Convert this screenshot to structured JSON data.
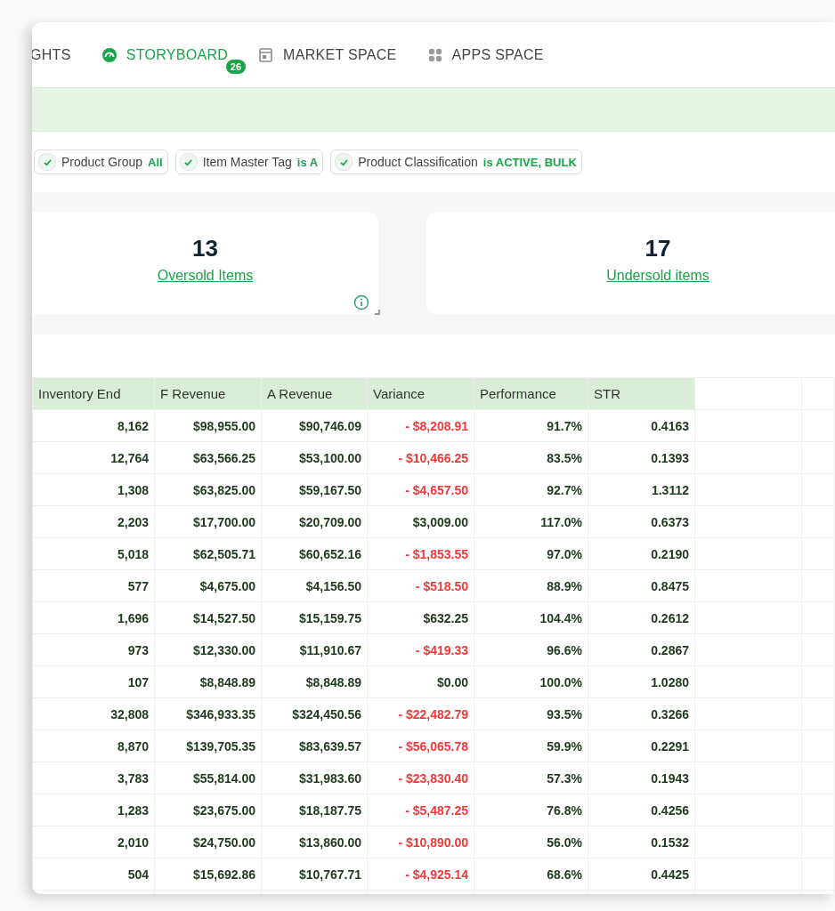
{
  "tabs": [
    {
      "label": "GHTS",
      "kind": "plain",
      "selected": false
    },
    {
      "label": "STORYBOARD",
      "kind": "gauge",
      "selected": true,
      "badge": "26"
    },
    {
      "label": "MARKET SPACE",
      "kind": "store",
      "selected": false
    },
    {
      "label": "APPS SPACE",
      "kind": "apps",
      "selected": false
    }
  ],
  "filters": [
    {
      "label": "Product Group",
      "value": "All",
      "checked": true
    },
    {
      "label": "Item Master Tag",
      "value": "is A",
      "checked": true
    },
    {
      "label": "Product Classification",
      "value": "is ACTIVE, BULK",
      "checked": true
    }
  ],
  "cards": [
    {
      "value": "13",
      "link": "Oversold Items",
      "info": true
    },
    {
      "value": "17",
      "link": "Undersold items",
      "info": false
    }
  ],
  "table": {
    "columns": [
      "Inventory End",
      "F Revenue",
      "A Revenue",
      "Variance",
      "Performance",
      "STR"
    ],
    "rows": [
      {
        "cells": [
          "8,162",
          "$98,955.00",
          "$90,746.09",
          "- $8,208.91",
          "91.7%",
          "0.4163"
        ],
        "negative": true
      },
      {
        "cells": [
          "12,764",
          "$63,566.25",
          "$53,100.00",
          "- $10,466.25",
          "83.5%",
          "0.1393"
        ],
        "negative": true
      },
      {
        "cells": [
          "1,308",
          "$63,825.00",
          "$59,167.50",
          "- $4,657.50",
          "92.7%",
          "1.3112"
        ],
        "negative": true
      },
      {
        "cells": [
          "2,203",
          "$17,700.00",
          "$20,709.00",
          "$3,009.00",
          "117.0%",
          "0.6373"
        ],
        "negative": false
      },
      {
        "cells": [
          "5,018",
          "$62,505.71",
          "$60,652.16",
          "- $1,853.55",
          "97.0%",
          "0.2190"
        ],
        "negative": true
      },
      {
        "cells": [
          "577",
          "$4,675.00",
          "$4,156.50",
          "- $518.50",
          "88.9%",
          "0.8475"
        ],
        "negative": true
      },
      {
        "cells": [
          "1,696",
          "$14,527.50",
          "$15,159.75",
          "$632.25",
          "104.4%",
          "0.2612"
        ],
        "negative": false
      },
      {
        "cells": [
          "973",
          "$12,330.00",
          "$11,910.67",
          "- $419.33",
          "96.6%",
          "0.2867"
        ],
        "negative": true
      },
      {
        "cells": [
          "107",
          "$8,848.89",
          "$8,848.89",
          "$0.00",
          "100.0%",
          "1.0280"
        ],
        "negative": false
      },
      {
        "cells": [
          "32,808",
          "$346,933.35",
          "$324,450.56",
          "- $22,482.79",
          "93.5%",
          "0.3266"
        ],
        "negative": true
      },
      {
        "cells": [
          "8,870",
          "$139,705.35",
          "$83,639.57",
          "- $56,065.78",
          "59.9%",
          "0.2291"
        ],
        "negative": true
      },
      {
        "cells": [
          "3,783",
          "$55,814.00",
          "$31,983.60",
          "- $23,830.40",
          "57.3%",
          "0.1943"
        ],
        "negative": true
      },
      {
        "cells": [
          "1,283",
          "$23,675.00",
          "$18,187.75",
          "- $5,487.25",
          "76.8%",
          "0.4256"
        ],
        "negative": true
      },
      {
        "cells": [
          "2,010",
          "$24,750.00",
          "$13,860.00",
          "- $10,890.00",
          "56.0%",
          "0.1532"
        ],
        "negative": true
      },
      {
        "cells": [
          "504",
          "$15,692.86",
          "$10,767.71",
          "- $4,925.14",
          "68.6%",
          "0.4425"
        ],
        "negative": true
      }
    ]
  }
}
